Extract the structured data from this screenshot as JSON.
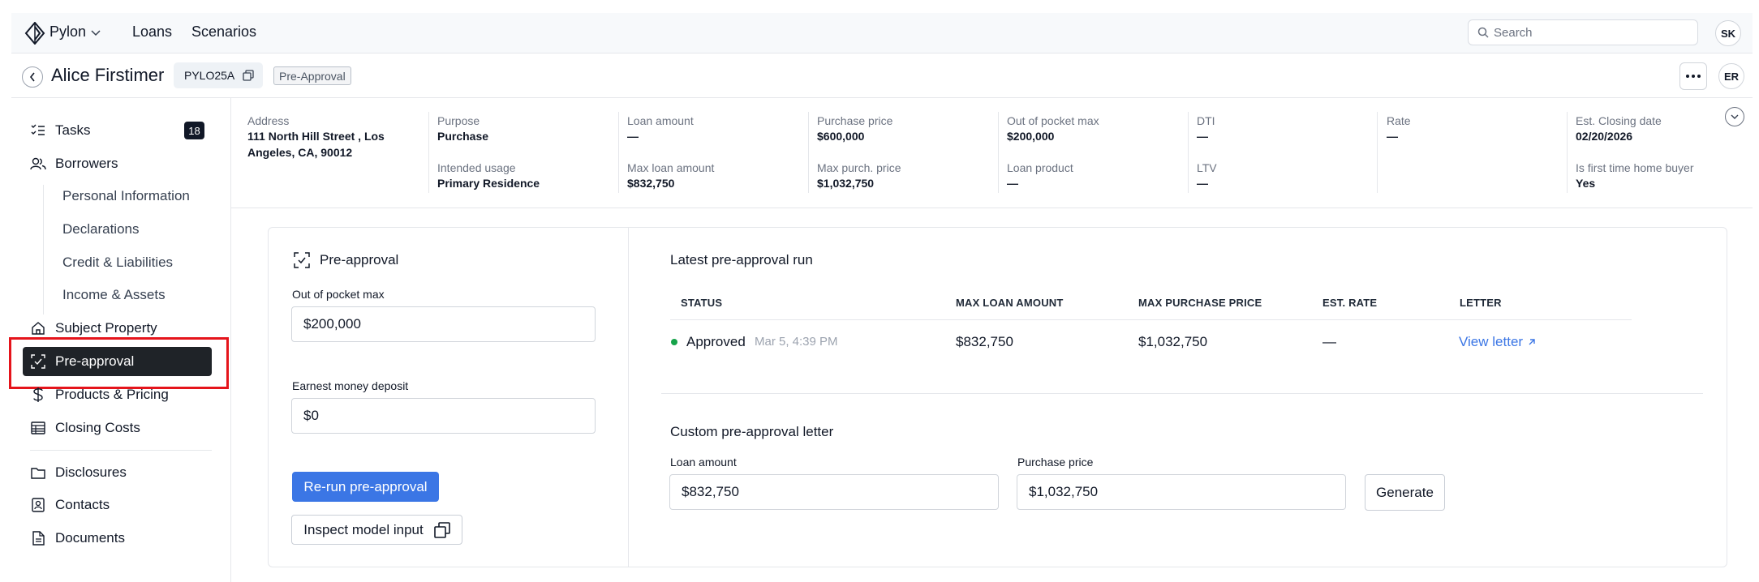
{
  "topbar": {
    "brand": "Pylon",
    "nav": [
      "Loans",
      "Scenarios"
    ],
    "search_placeholder": "Search",
    "user_initials": "SK"
  },
  "header": {
    "borrower_name": "Alice Firstimer",
    "loan_id": "PYLO25A",
    "stage": "Pre-Approval",
    "assignee_initials": "ER"
  },
  "sidebar": {
    "tasks_label": "Tasks",
    "tasks_count": "18",
    "borrowers_label": "Borrowers",
    "borrower_subitems": [
      "Personal Information",
      "Declarations",
      "Credit & Liabilities",
      "Income & Assets"
    ],
    "items": [
      {
        "label": "Subject Property",
        "icon": "house-icon"
      },
      {
        "label": "Pre-approval",
        "icon": "scan-check-icon"
      },
      {
        "label": "Products & Pricing",
        "icon": "dollar-icon"
      },
      {
        "label": "Closing Costs",
        "icon": "table-icon"
      }
    ],
    "items2": [
      {
        "label": "Disclosures",
        "icon": "folder-icon"
      },
      {
        "label": "Contacts",
        "icon": "contact-icon"
      },
      {
        "label": "Documents",
        "icon": "document-icon"
      }
    ]
  },
  "summary": [
    {
      "label1": "Address",
      "value1": "111 North Hill Street , Los Angeles, CA, 90012",
      "label2": "",
      "value2": ""
    },
    {
      "label1": "Purpose",
      "value1": "Purchase",
      "label2": "Intended usage",
      "value2": "Primary Residence"
    },
    {
      "label1": "Loan amount",
      "value1": "—",
      "label2": "Max loan amount",
      "value2": "$832,750"
    },
    {
      "label1": "Purchase price",
      "value1": "$600,000",
      "label2": "Max purch. price",
      "value2": "$1,032,750"
    },
    {
      "label1": "Out of pocket max",
      "value1": "$200,000",
      "label2": "Loan product",
      "value2": "—"
    },
    {
      "label1": "DTI",
      "value1": "—",
      "label2": "LTV",
      "value2": "—"
    },
    {
      "label1": "Rate",
      "value1": "—",
      "label2": "",
      "value2": ""
    },
    {
      "label1": "Est. Closing date",
      "value1": "02/20/2026",
      "label2": "Is first time home buyer",
      "value2": "Yes"
    }
  ],
  "preapproval": {
    "title": "Pre-approval",
    "oop_label": "Out of pocket max",
    "oop_value": "$200,000",
    "emd_label": "Earnest money deposit",
    "emd_value": "$0",
    "rerun_label": "Re-run pre-approval",
    "inspect_label": "Inspect model input"
  },
  "latest_run": {
    "title": "Latest pre-approval run",
    "columns": [
      "STATUS",
      "MAX LOAN AMOUNT",
      "MAX PURCHASE PRICE",
      "EST. RATE",
      "LETTER"
    ],
    "row": {
      "status": "Approved",
      "timestamp": "Mar 5, 4:39 PM",
      "max_loan": "$832,750",
      "max_purchase": "$1,032,750",
      "est_rate": "—",
      "letter_link": "View letter"
    },
    "status_color": "#16a34a"
  },
  "custom_letter": {
    "title": "Custom pre-approval letter",
    "loan_label": "Loan amount",
    "loan_value": "$832,750",
    "price_label": "Purchase price",
    "price_value": "$1,032,750",
    "generate_label": "Generate"
  },
  "colors": {
    "accent": "#3b76e5",
    "active_nav": "#1f2328",
    "highlight": "#e5141b"
  }
}
